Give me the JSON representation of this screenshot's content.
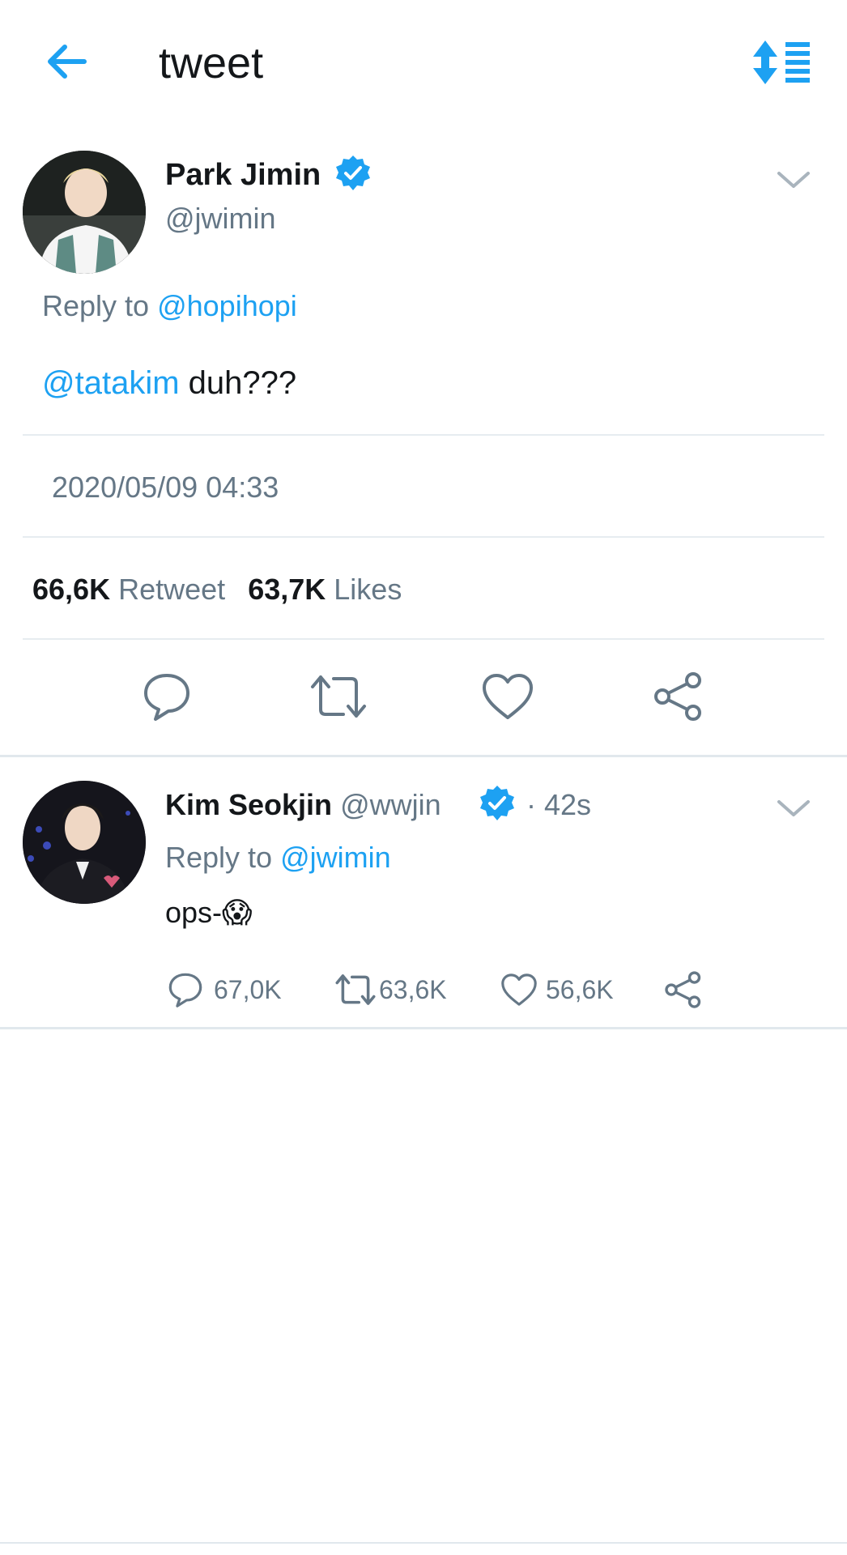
{
  "header": {
    "title": "tweet",
    "back_icon": "arrow-left-icon",
    "sort_icon": "sort-list-icon"
  },
  "main_tweet": {
    "display_name": "Park Jimin",
    "handle": "@jwimin",
    "reply_prefix": "Reply to",
    "reply_target": "@hopihopi",
    "mention": "@tatakim",
    "text": "duh???",
    "timestamp": "2020/05/09 04:33",
    "retweet_count": "66,6K",
    "retweet_label": "Retweet",
    "like_count": "63,7K",
    "like_label": "Likes"
  },
  "reply_tweet": {
    "display_name": "Kim Seokjin",
    "handle": "@wwjin",
    "time_ago": "· 42s",
    "reply_prefix": "Reply to",
    "reply_target": "@jwimin",
    "text": "ops-",
    "emoji": "😱",
    "reply_count": "67,0K",
    "retweet_count": "63,6K",
    "like_count": "56,6K"
  },
  "colors": {
    "accent": "#1da1f2",
    "text": "#14171a",
    "secondary": "#657786",
    "divider": "#e6ecf0"
  }
}
